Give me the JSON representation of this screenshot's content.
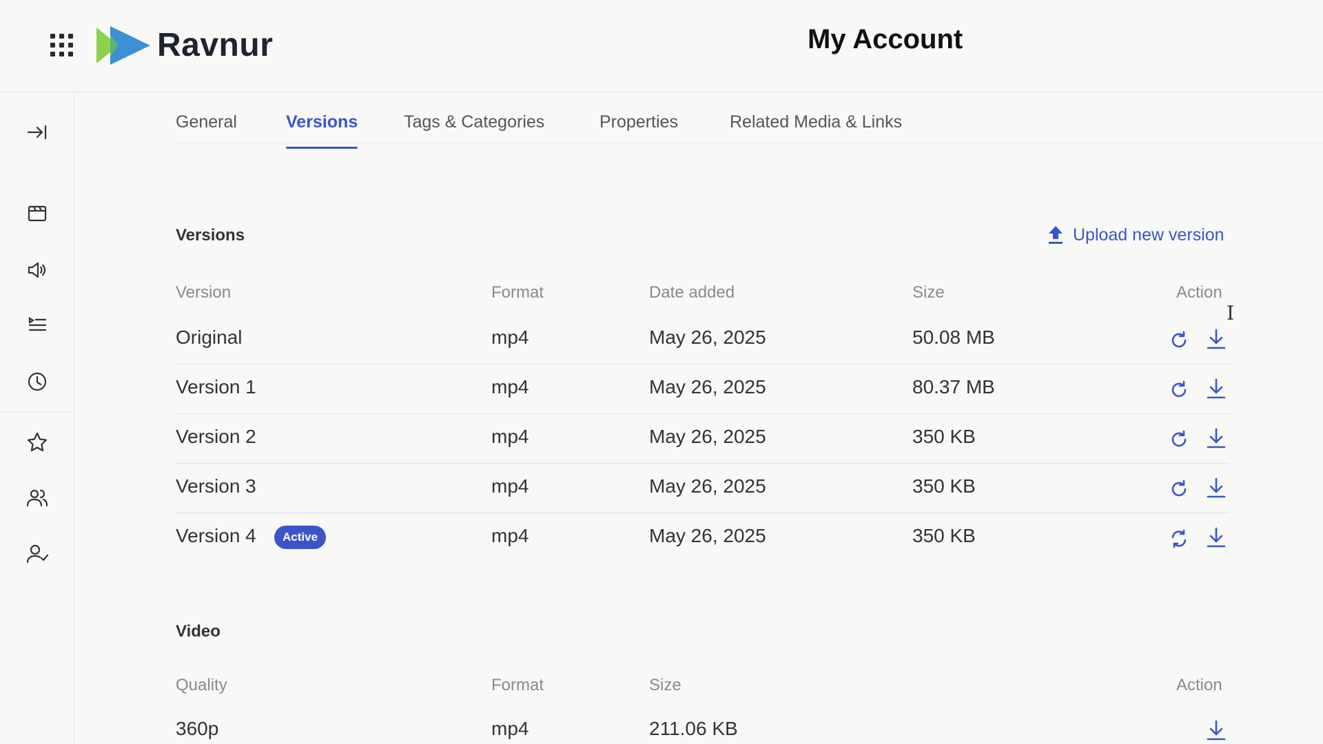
{
  "header": {
    "brand": "Ravnur",
    "page_title": "My Account",
    "logo_colors": {
      "green": "#8ed14a",
      "blue": "#3d8fd6"
    }
  },
  "sidebar": {
    "items": [
      {
        "name": "collapse-icon"
      },
      {
        "name": "media-library-icon"
      },
      {
        "name": "audio-icon"
      },
      {
        "name": "playlist-icon"
      },
      {
        "name": "history-icon"
      },
      {
        "name": "favorites-icon"
      },
      {
        "name": "groups-icon"
      },
      {
        "name": "users-approved-icon"
      }
    ]
  },
  "tabs": [
    {
      "label": "General",
      "active": false
    },
    {
      "label": "Versions",
      "active": true
    },
    {
      "label": "Tags & Categories",
      "active": false
    },
    {
      "label": "Properties",
      "active": false
    },
    {
      "label": "Related Media & Links",
      "active": false
    }
  ],
  "versions": {
    "title": "Versions",
    "upload_label": "Upload new version",
    "columns": [
      "Version",
      "Format",
      "Date added",
      "Size",
      "Action"
    ],
    "rows": [
      {
        "version": "Original",
        "format": "mp4",
        "date": "May 26, 2025",
        "size": "50.08 MB",
        "active": false
      },
      {
        "version": "Version 1",
        "format": "mp4",
        "date": "May 26, 2025",
        "size": "80.37 MB",
        "active": false
      },
      {
        "version": "Version 2",
        "format": "mp4",
        "date": "May 26, 2025",
        "size": "350 KB",
        "active": false
      },
      {
        "version": "Version 3",
        "format": "mp4",
        "date": "May 26, 2025",
        "size": "350 KB",
        "active": false
      },
      {
        "version": "Version 4",
        "format": "mp4",
        "date": "May 26, 2025",
        "size": "350 KB",
        "active": true,
        "badge": "Active"
      }
    ]
  },
  "video": {
    "title": "Video",
    "columns": [
      "Quality",
      "Format",
      "Size",
      "Action"
    ],
    "rows": [
      {
        "quality": "360p",
        "format": "mp4",
        "size": "211.06 KB"
      }
    ]
  },
  "colors": {
    "accent": "#3b55c9",
    "text": "#333333",
    "muted": "#8a8a8a"
  }
}
